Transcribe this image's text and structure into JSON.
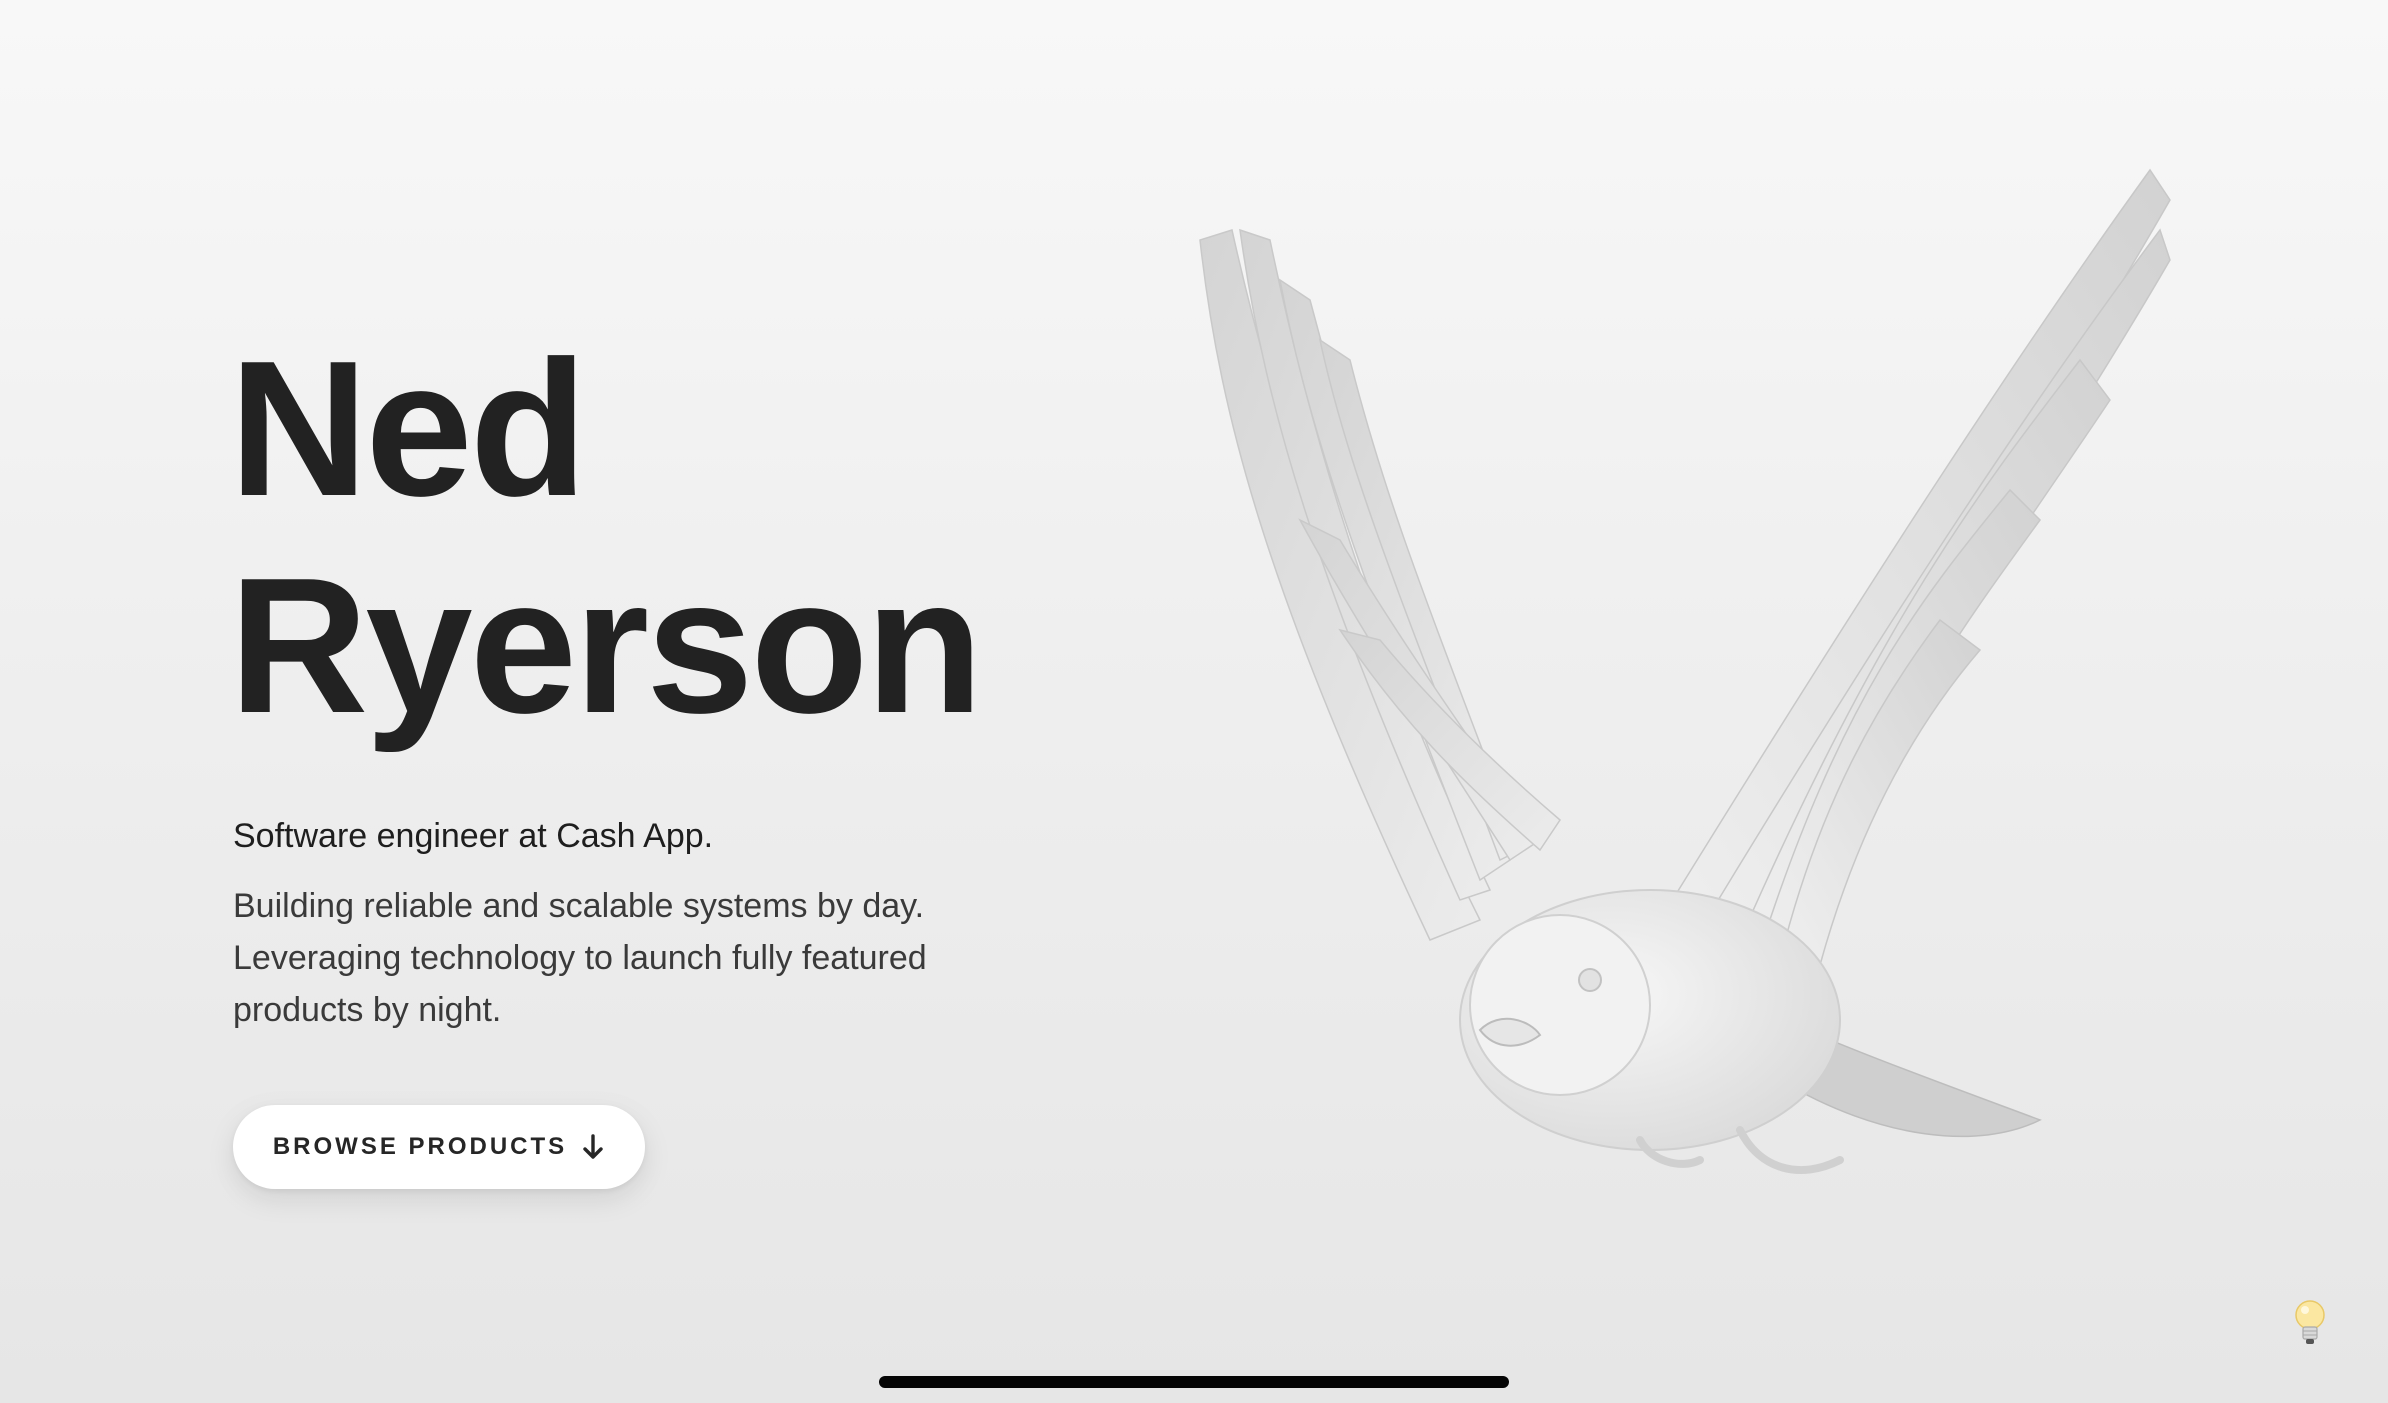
{
  "hero": {
    "name_line1": "Ned",
    "name_line2": "Ryerson",
    "subtitle": "Software engineer at Cash App.",
    "description_lines": [
      "Building reliable and scalable systems by day.",
      "Leveraging technology to launch fully featured",
      "products by night."
    ]
  },
  "cta": {
    "label": "BROWSE PRODUCTS",
    "icon": "arrow-down-icon"
  },
  "illustration": {
    "subject": "bird-figure",
    "color": "#e6e6e6"
  },
  "theme_toggle": {
    "icon": "lightbulb-icon",
    "color": "#f5d76e"
  },
  "colors": {
    "text": "#222222",
    "background": "#efefef",
    "button": "#ffffff"
  }
}
